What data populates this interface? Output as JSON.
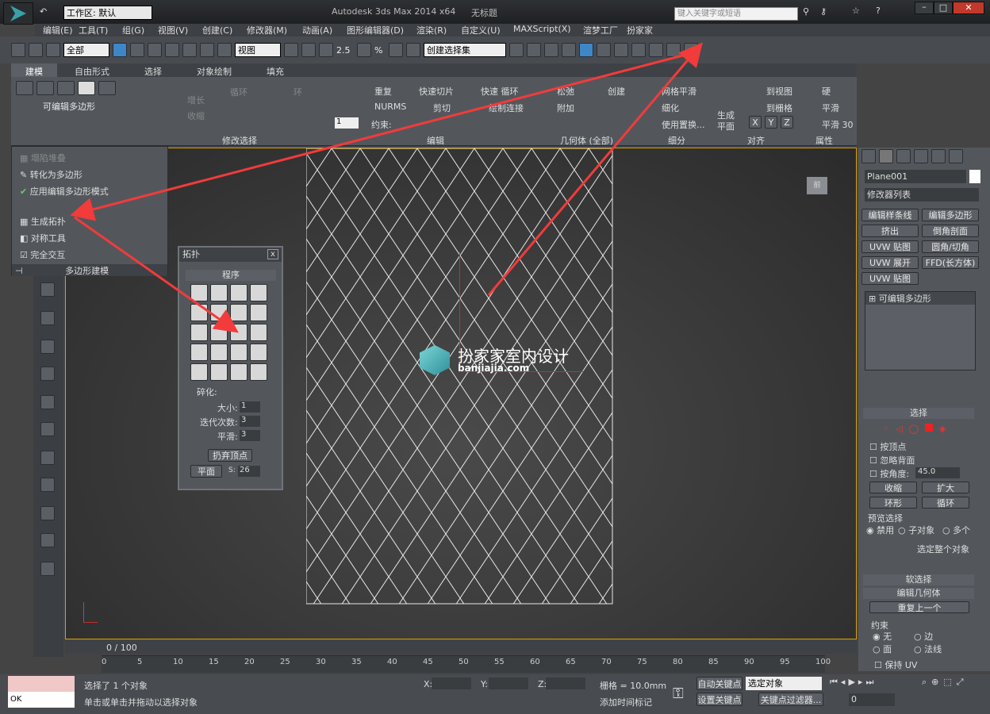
{
  "titlebar": {
    "title": "Autodesk 3ds Max  2014 x64",
    "doc": "无标题",
    "workspace": "工作区: 默认",
    "search_placeholder": "键入关键字或短语"
  },
  "menu": [
    "编辑(E)",
    "工具(T)",
    "组(G)",
    "视图(V)",
    "创建(C)",
    "修改器(M)",
    "动画(A)",
    "图形编辑器(D)",
    "渲染(R)",
    "自定义(U)",
    "MAXScript(X)",
    "渲梦工厂",
    "扮家家"
  ],
  "toolbar": {
    "filter": "全部",
    "refcoord": "视图",
    "selset": "创建选择集",
    "snap_angle": "2.5",
    "snap_pct": "%"
  },
  "ribbon": {
    "tabs": [
      "建模",
      "自由形式",
      "选择",
      "对象绘制",
      "填充"
    ],
    "editable_poly": "可编辑多边形",
    "loop": "循环",
    "ring": "环",
    "grow": "增长",
    "shrink": "收缩",
    "modsel": "修改选择",
    "edit_label": "编辑",
    "repeat": "重复",
    "quickslice": "快速切片",
    "quickloop": "快速 循环",
    "nurms": "NURMS",
    "cut": "剪切",
    "paintconn": "绘制连接",
    "constraint": "约束:",
    "spin_val": "1",
    "relax": "松弛",
    "create": "创建",
    "attach": "附加",
    "geom_all": "几何体 (全部)",
    "meshsmooth": "网格平滑",
    "tessellate": "细化",
    "usedisp": "使用置换...",
    "subdiv": "细分",
    "genplane": "生成",
    "genplane2": "平面",
    "toview": "到视图",
    "togrid": "到栅格",
    "align": "对齐",
    "hard": "硬",
    "smooth": "平滑",
    "smooth30": "平滑 30",
    "props": "属性",
    "x": "X",
    "y": "Y",
    "z": "Z"
  },
  "dropdown": [
    "塌陷堆叠",
    "转化为多边形",
    "应用编辑多边形模式",
    "生成拓扑",
    "对称工具",
    "完全交互"
  ],
  "dropdown_footer": "多边形建模",
  "topo": {
    "title": "拓扑",
    "close": "x",
    "program": "程序",
    "tess": "碎化:",
    "size_l": "大小:",
    "size": "1",
    "iter_l": "迭代次数:",
    "iter": "3",
    "smooth_l": "平滑:",
    "smooth": "3",
    "discard": "扔弃顶点",
    "plane": "平面",
    "s_l": "S:",
    "s": "26"
  },
  "watermark": {
    "cn": "扮家家室内设计",
    "url": "banjiajia.com"
  },
  "viewcube": "前",
  "cmd": {
    "objname": "Plane001",
    "modlist": "修改器列表",
    "btns": [
      "编辑样条线",
      "编辑多边形",
      "挤出",
      "倒角剖面",
      "UVW 贴图",
      "圆角/切角",
      "UVW 展开",
      "FFD(长方体)",
      "UVW 贴图"
    ],
    "stack": "可编辑多边形",
    "sel_title": "选择",
    "byvert": "按顶点",
    "ignoreback": "忽略背面",
    "byangle": "按角度:",
    "angle": "45.0",
    "shrink": "收缩",
    "grow": "扩大",
    "ring": "环形",
    "loop": "循环",
    "preview": "预览选择",
    "disable": "禁用",
    "subobj": "子对象",
    "multi": "多个",
    "selwhole": "选定整个对象",
    "softsel": "软选择",
    "editgeo": "编辑几何体",
    "repeatlast": "重复上一个",
    "constraints": "约束",
    "none": "无",
    "edge": "边",
    "face": "面",
    "normal": "法线",
    "preserveuv": "保持 UV"
  },
  "timeline": {
    "frame": "0 / 100",
    "ticks": [
      "0",
      "5",
      "10",
      "15",
      "20",
      "25",
      "30",
      "35",
      "40",
      "45",
      "50",
      "55",
      "60",
      "65",
      "70",
      "75",
      "80",
      "85",
      "90",
      "95",
      "100"
    ]
  },
  "status": {
    "ok": "OK",
    "selected": "选择了 1 个对象",
    "prompt": "单击或单击并拖动以选择对象",
    "x": "X:",
    "y": "Y:",
    "z": "Z:",
    "grid": "栅格 = 10.0mm",
    "addtime": "添加时间标记",
    "autokey": "自动关键点",
    "setkey": "设置关键点",
    "selobj": "选定对象",
    "keyfilter": "关键点过滤器...",
    "frameval": "0"
  }
}
